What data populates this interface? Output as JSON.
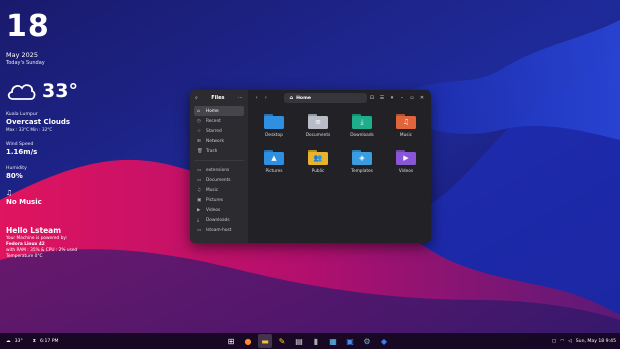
{
  "widget": {
    "day": "18",
    "month_year": "May 2025",
    "day_label": "Today's Sunday",
    "temperature": "33°",
    "city": "Kuala Lumpur",
    "condition": "Overcast Clouds",
    "minmax": "Max : 33°C    Min : 32°C",
    "wind_label": "Wind Speed",
    "wind_value": "1.16m/s",
    "humidity_label": "Humidity",
    "humidity_value": "80%",
    "music_note": "♫",
    "music_status": "No Music",
    "hello": "Hello Lsteam",
    "sys_line1": "Your Machine is powered by:",
    "sys_line2": "Fedora Linux 42",
    "sys_line3": "with RAM : 35% & CPU : 2% used",
    "sys_line4": "Temperature 0°C"
  },
  "files": {
    "app_title": "Files",
    "location": "Home",
    "sidebar": [
      {
        "label": "Home",
        "icon": "⌂",
        "active": true
      },
      {
        "label": "Recent",
        "icon": "◷"
      },
      {
        "label": "Starred",
        "icon": "☆"
      },
      {
        "label": "Network",
        "icon": "⊞"
      },
      {
        "label": "Trash",
        "icon": "🗑"
      }
    ],
    "bookmarks": [
      {
        "label": "extensions",
        "icon": "▭"
      },
      {
        "label": "Documents",
        "icon": "▭"
      },
      {
        "label": "Music",
        "icon": "♫"
      },
      {
        "label": "Pictures",
        "icon": "▣"
      },
      {
        "label": "Videos",
        "icon": "▶"
      },
      {
        "label": "Downloads",
        "icon": "⤓"
      },
      {
        "label": "lsteam-host",
        "icon": "▭"
      }
    ],
    "folders": [
      {
        "name": "Desktop",
        "color": "#2f8fe0",
        "symbol": ""
      },
      {
        "name": "Documents",
        "color": "#b7bcc6",
        "symbol": "≡"
      },
      {
        "name": "Downloads",
        "color": "#1fae8c",
        "symbol": "⤓"
      },
      {
        "name": "Music",
        "color": "#e0643c",
        "symbol": "♫"
      },
      {
        "name": "Pictures",
        "color": "#2f8fe0",
        "symbol": "▲"
      },
      {
        "name": "Public",
        "color": "#e9b32c",
        "symbol": "👥"
      },
      {
        "name": "Templates",
        "color": "#3a9de0",
        "symbol": "◈"
      },
      {
        "name": "Videos",
        "color": "#8a56d8",
        "symbol": "▶"
      }
    ]
  },
  "taskbar": {
    "weather": "33°",
    "time": "6:17 PM",
    "clock": "Sun, May 18  9:45"
  }
}
